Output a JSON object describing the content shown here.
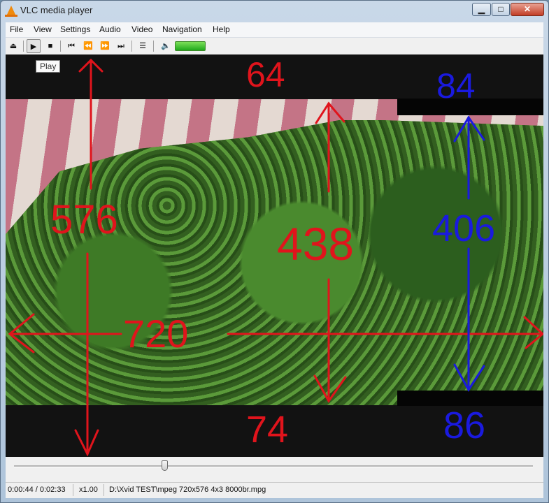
{
  "window": {
    "title": "VLC media player",
    "min_glyph": "▁",
    "max_glyph": "□",
    "close_glyph": "✕"
  },
  "menu": [
    "File",
    "View",
    "Settings",
    "Audio",
    "Video",
    "Navigation",
    "Help"
  ],
  "toolbar": {
    "eject_glyph": "⏏",
    "play_glyph": "▶",
    "stop_glyph": "■",
    "prev_glyph": "⏮",
    "rewind_glyph": "⏪",
    "forward_glyph": "⏩",
    "next_glyph": "⏭",
    "playlist_glyph": "☰",
    "volume_glyph": "🔈",
    "volume_level": 1.0,
    "tooltip": "Play"
  },
  "annotations": {
    "top_bar": "64",
    "full_height": "576",
    "width": "720",
    "picture_height": "438",
    "bottom_bar": "74",
    "top_bar_right": "84",
    "picture_height_right": "406",
    "bottom_bar_right": "86"
  },
  "colors": {
    "annotation_red": "#e0141c",
    "annotation_blue": "#1a1adf",
    "volume_green": "#1fa81c"
  },
  "seek": {
    "position": 0.29
  },
  "status": {
    "time": "0:00:44 / 0:02:33",
    "speed": "x1.00",
    "file": "D:\\Xvid TEST\\mpeg 720x576 4x3 8000br.mpg"
  }
}
